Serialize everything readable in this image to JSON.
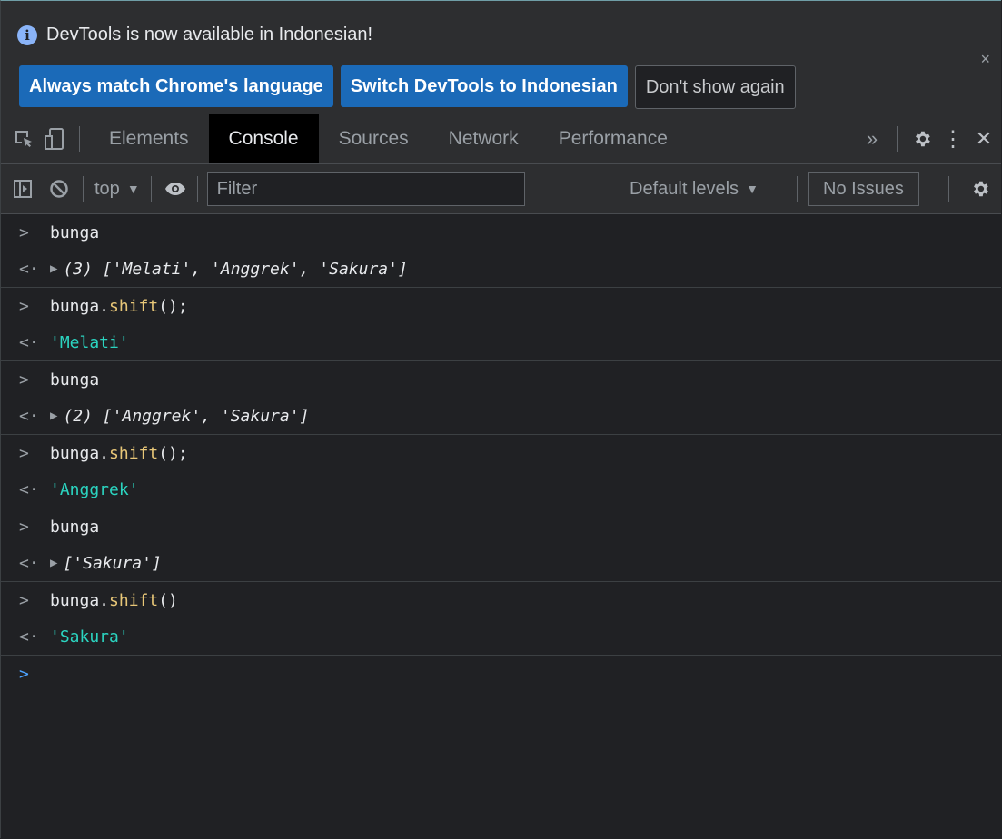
{
  "infobar": {
    "message": "DevTools is now available in Indonesian!",
    "info_icon": "i",
    "close_label": "×",
    "buttons": {
      "always_match": "Always match Chrome's language",
      "switch": "Switch DevTools to Indonesian",
      "dont_show": "Don't show again"
    }
  },
  "tabs": {
    "elements": "Elements",
    "console": "Console",
    "sources": "Sources",
    "network": "Network",
    "performance": "Performance",
    "more": "»",
    "kebab": "⋮",
    "close": "✕"
  },
  "toolbar": {
    "context": "top",
    "context_arrow": "▼",
    "filter_placeholder": "Filter",
    "levels": "Default levels",
    "levels_arrow": "▼",
    "issues": "No Issues"
  },
  "console": {
    "g1_input": "bunga",
    "g1_count": "(3)",
    "g1_open": "[",
    "g1_v1": "'Melati'",
    "g1_v2": "'Anggrek'",
    "g1_v3": "'Sakura'",
    "g1_close": "]",
    "g2_obj": "bunga.",
    "g2_fn": "shift",
    "g2_tail": "();",
    "g2_result": "'Melati'",
    "g3_input": "bunga",
    "g3_count": "(2)",
    "g3_open": "[",
    "g3_v1": "'Anggrek'",
    "g3_v2": "'Sakura'",
    "g3_close": "]",
    "g4_obj": "bunga.",
    "g4_fn": "shift",
    "g4_tail": "();",
    "g4_result": "'Anggrek'",
    "g5_input": "bunga",
    "g5_open": "[",
    "g5_v1": "'Sakura'",
    "g5_close": "]",
    "g6_obj": "bunga.",
    "g6_fn": "shift",
    "g6_tail": "()",
    "g6_result": "'Sakura'",
    "sep": ", ",
    "input_prompt": ">",
    "output_prompt": "<·"
  },
  "colors": {
    "string": "#2bd4c0",
    "function": "#e8c778",
    "primary_button": "#1b6ab8",
    "active_prompt": "#4da3ff"
  }
}
